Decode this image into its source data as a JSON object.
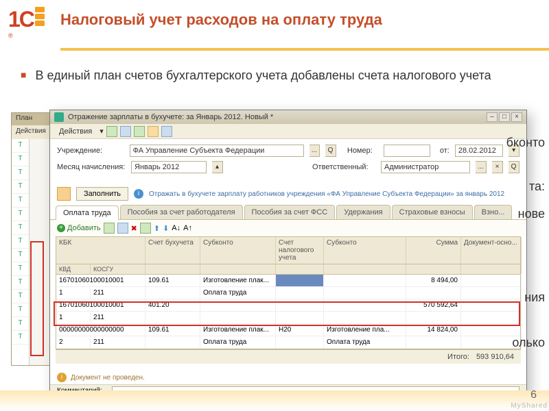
{
  "slide": {
    "title": "Налоговый учет расходов на оплату труда",
    "bullet_text": "В единый план счетов бухгалтерского учета добавлены счета налогового учета",
    "page_number": "6",
    "watermark": "MyShared"
  },
  "plan_window": {
    "title": "План",
    "actions": "Действия",
    "side_marks": [
      "Т",
      "Т",
      "Т",
      "Т",
      "Т",
      "Т",
      "Т",
      "Т",
      "Т",
      "Т",
      "Т",
      "Т",
      "Т",
      "Т",
      "Т",
      "Т",
      "Т"
    ]
  },
  "doc_window": {
    "title": "Отражение зарплаты в бухучете: за Январь 2012. Новый *",
    "actions_label": "Действия",
    "form": {
      "institution_label": "Учреждение:",
      "institution_value": "ФА Управление Субъекта Федерации",
      "number_label": "Номер:",
      "number_value": "",
      "date_label": "от:",
      "date_value": "28.02.2012",
      "month_label": "Месяц начисления:",
      "month_value": "Январь 2012",
      "responsible_label": "Ответственный:",
      "responsible_value": "Администратор"
    },
    "fill_button": "Заполнить",
    "info_text": "Отражать в бухучете зарплату работников учреждения «ФА Управление Субъекта Федерации» за январь 2012",
    "tabs": [
      "Оплата труда",
      "Пособия за счет работодателя",
      "Пособия за счет ФСС",
      "Удержания",
      "Страховые взносы",
      "Взно..."
    ],
    "add_button": "Добавить",
    "columns": {
      "kbk": "КБК",
      "kvd": "КВД",
      "kosgu": "КОСГУ",
      "acct": "Счет бухучета",
      "sub": "Субконто",
      "tax_acct": "Счет налогового учета",
      "tax_sub": "Субконто",
      "sum": "Сумма",
      "doc": "Документ-осно..."
    },
    "rows": [
      {
        "kbk": "16701060100010001",
        "kvd": "1",
        "kosgu": "211",
        "acct": "109.61",
        "sub1": "Изготовление плак...",
        "sub2": "Оплата труда",
        "tax_acct": "",
        "tax_sub1": "",
        "tax_sub2": "",
        "sum": "8 494,00",
        "doc": ""
      },
      {
        "kbk": "16701060100010001",
        "kvd": "1",
        "kosgu": "211",
        "acct": "401.20",
        "sub1": "",
        "sub2": "",
        "tax_acct": "",
        "tax_sub1": "",
        "tax_sub2": "",
        "sum": "570 592,64",
        "doc": ""
      },
      {
        "kbk": "00000000000000000",
        "kvd": "2",
        "kosgu": "211",
        "acct": "109.61",
        "sub1": "Изготовление плак...",
        "sub2": "Оплата труда",
        "tax_acct": "Н20",
        "tax_sub1": "Изготовление пла...",
        "tax_sub2": "Оплата труда",
        "sum": "14 824,00",
        "doc": ""
      }
    ],
    "total_label": "Итого:",
    "total_value": "593 910,64",
    "status_text": "Документ не проведен.",
    "comment_label": "Комментарий:"
  },
  "fragments": {
    "f1": "бконто",
    "f2": "та:",
    "f3": "нове",
    "f4": "ния",
    "f5": "олько"
  }
}
